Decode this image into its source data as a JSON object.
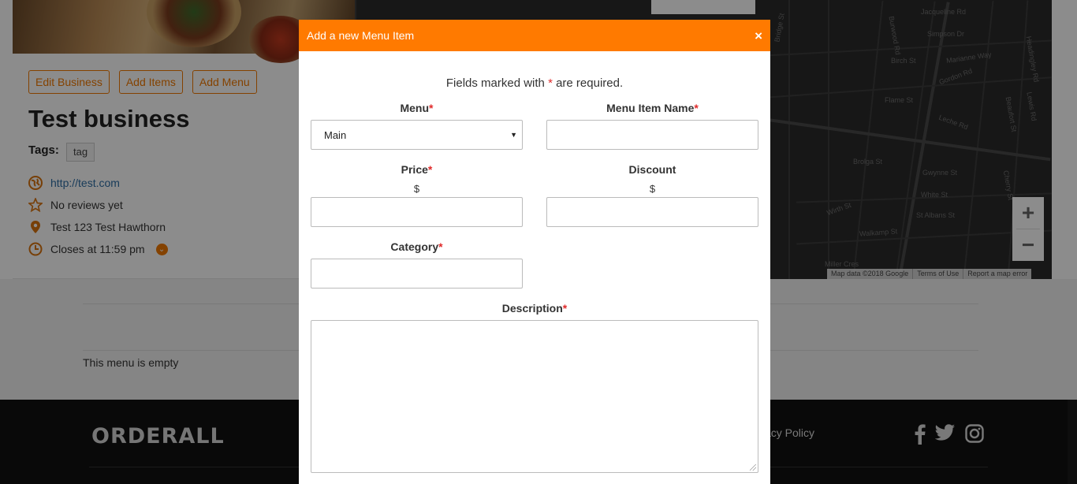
{
  "business": {
    "buttons": {
      "edit": "Edit Business",
      "add_items": "Add Items",
      "add_menu": "Add Menu"
    },
    "title": "Test business",
    "tags_label": "Tags:",
    "tag": "tag",
    "website": "http://test.com",
    "reviews": "No reviews yet",
    "address": "Test 123 Test Hawthorn",
    "hours": "Closes at 11:59 pm"
  },
  "map": {
    "labels": [
      "Jacqueline Rd",
      "Simpson Dr",
      "Burwood Rd",
      "Birch St",
      "Marianne Way",
      "Gordon Rd",
      "Flame St",
      "Leche Rd",
      "Beaufort St",
      "Headingley Rd",
      "Bridge St",
      "Brolga St",
      "Gwynne St",
      "White St",
      "St Albans St",
      "Wirth St",
      "Walkamp St",
      "Miller Cres",
      "Cherry St",
      "Lewis Rd"
    ],
    "attribution": [
      "Map data ©2018 Google",
      "Terms of Use",
      "Report a map error"
    ],
    "zoom_in": "+",
    "zoom_out": "−"
  },
  "menu": {
    "empty_text": "This menu is empty"
  },
  "footer": {
    "logo": "ORDERALL",
    "privacy": "acy Policy"
  },
  "modal": {
    "title": "Add a new Menu Item",
    "close": "×",
    "required_note_prefix": "Fields marked with ",
    "required_star": "*",
    "required_note_suffix": " are required.",
    "fields": {
      "menu": {
        "label": "Menu",
        "value": "Main"
      },
      "item_name": {
        "label": "Menu Item Name",
        "value": ""
      },
      "price": {
        "label": "Price",
        "currency": "$",
        "value": ""
      },
      "discount": {
        "label": "Discount",
        "currency": "$",
        "value": ""
      },
      "category": {
        "label": "Category",
        "value": ""
      },
      "description": {
        "label": "Description",
        "value": ""
      }
    }
  },
  "colors": {
    "accent": "#ff7a00",
    "required": "#e02a2a"
  }
}
